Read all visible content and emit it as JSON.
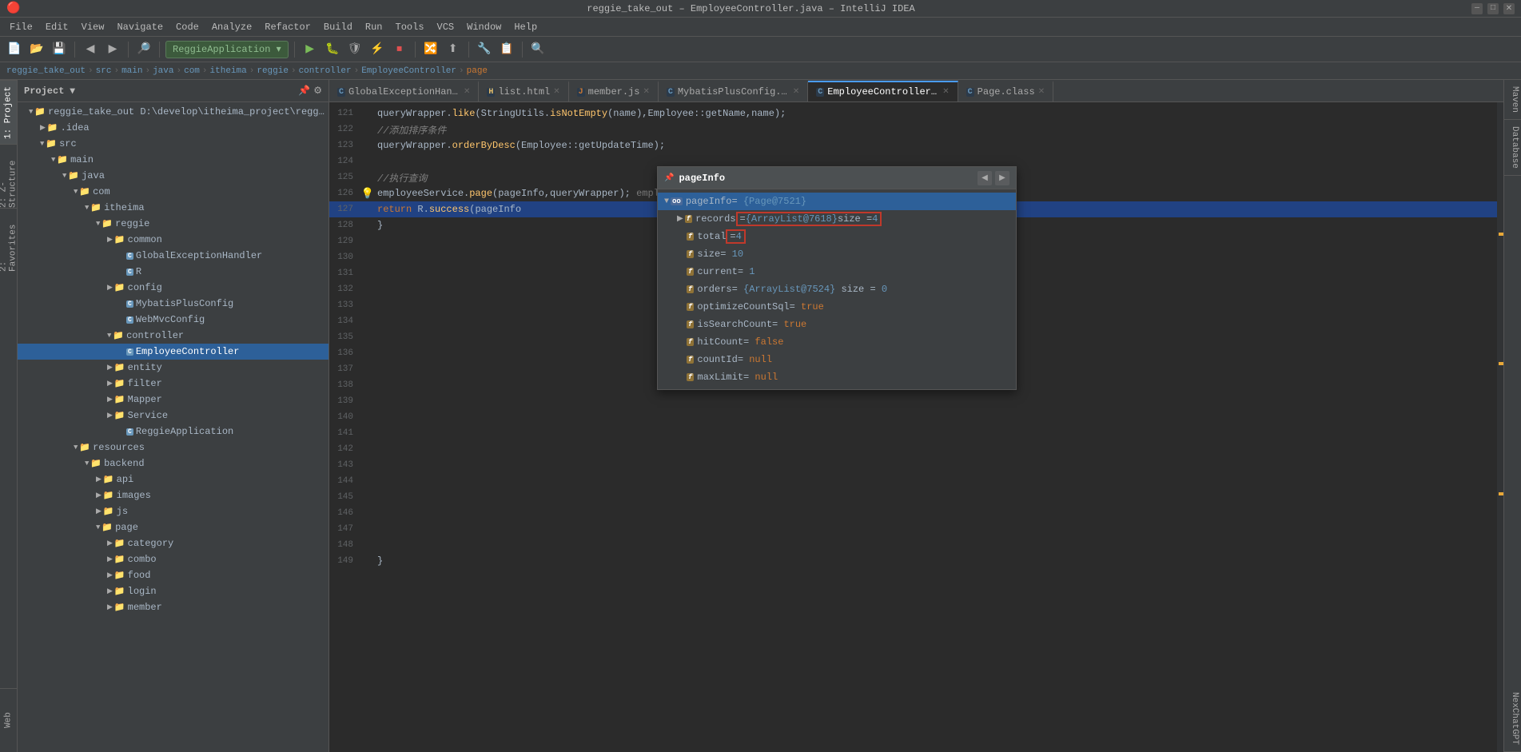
{
  "titlebar": {
    "title": "reggie_take_out – EmployeeController.java – IntelliJ IDEA",
    "min": "—",
    "max": "□",
    "close": "✕"
  },
  "menubar": {
    "items": [
      "File",
      "Edit",
      "View",
      "Navigate",
      "Code",
      "Analyze",
      "Refactor",
      "Build",
      "Run",
      "Tools",
      "VCS",
      "Window",
      "Help"
    ]
  },
  "breadcrumb": {
    "items": [
      "reggie_take_out",
      "src",
      "main",
      "java",
      "com",
      "itheima",
      "reggie",
      "controller",
      "EmployeeController"
    ],
    "current": "page"
  },
  "tabs": [
    {
      "id": "t1",
      "label": "GlobalExceptionHandler.java",
      "type": "c",
      "active": false
    },
    {
      "id": "t2",
      "label": "list.html",
      "type": "html",
      "active": false
    },
    {
      "id": "t3",
      "label": "member.js",
      "type": "js",
      "active": false
    },
    {
      "id": "t4",
      "label": "MybatisPlusConfig.java",
      "type": "c",
      "active": false
    },
    {
      "id": "t5",
      "label": "EmployeeController.java",
      "type": "c",
      "active": true
    },
    {
      "id": "t6",
      "label": "Page.class",
      "type": "c",
      "active": false
    }
  ],
  "code": {
    "lines": [
      {
        "num": "121",
        "content": "queryWrapper.like(StringUtils.isNotEmpty(name),Employee::getName,name);",
        "highlight": false,
        "selected": false
      },
      {
        "num": "122",
        "content": "//添加排序条件",
        "highlight": false,
        "selected": false
      },
      {
        "num": "123",
        "content": "queryWrapper.orderByDesc(Employee::getUpdateTime);",
        "highlight": false,
        "selected": false
      },
      {
        "num": "124",
        "content": "",
        "highlight": false,
        "selected": false
      },
      {
        "num": "125",
        "content": "//执行查询",
        "highlight": false,
        "selected": false
      },
      {
        "num": "126",
        "content": "employeeService.page(pageInfo,queryWrapper);  employeeService: \"com.itheima.reggie.Service.impl.EmployeeServ",
        "highlight": false,
        "selected": false,
        "warn": true
      },
      {
        "num": "127",
        "content": "return R.success(pageInfo",
        "highlight": true,
        "selected": true
      },
      {
        "num": "128",
        "content": "}",
        "highlight": false,
        "selected": false
      },
      {
        "num": "129",
        "content": "",
        "highlight": false,
        "selected": false
      },
      {
        "num": "130",
        "content": "",
        "highlight": false,
        "selected": false
      },
      {
        "num": "131",
        "content": "",
        "highlight": false,
        "selected": false
      },
      {
        "num": "132",
        "content": "",
        "highlight": false,
        "selected": false
      },
      {
        "num": "133",
        "content": "",
        "highlight": false,
        "selected": false
      },
      {
        "num": "134",
        "content": "",
        "highlight": false,
        "selected": false
      },
      {
        "num": "135",
        "content": "",
        "highlight": false,
        "selected": false
      },
      {
        "num": "136",
        "content": "",
        "highlight": false,
        "selected": false
      },
      {
        "num": "137",
        "content": "",
        "highlight": false,
        "selected": false
      },
      {
        "num": "138",
        "content": "",
        "highlight": false,
        "selected": false
      },
      {
        "num": "139",
        "content": "",
        "highlight": false,
        "selected": false
      },
      {
        "num": "140",
        "content": "",
        "highlight": false,
        "selected": false
      },
      {
        "num": "141",
        "content": "",
        "highlight": false,
        "selected": false
      },
      {
        "num": "142",
        "content": "",
        "highlight": false,
        "selected": false
      },
      {
        "num": "143",
        "content": "",
        "highlight": false,
        "selected": false
      },
      {
        "num": "144",
        "content": "",
        "highlight": false,
        "selected": false
      },
      {
        "num": "145",
        "content": "",
        "highlight": false,
        "selected": false
      },
      {
        "num": "146",
        "content": "",
        "highlight": false,
        "selected": false
      },
      {
        "num": "147",
        "content": "",
        "highlight": false,
        "selected": false
      },
      {
        "num": "148",
        "content": "",
        "highlight": false,
        "selected": false
      },
      {
        "num": "149",
        "content": "}",
        "highlight": false,
        "selected": false
      }
    ]
  },
  "debug_popup": {
    "title": "pageInfo",
    "nodes": [
      {
        "id": "n1",
        "indent": 0,
        "type": "obj",
        "expanded": true,
        "name": "pageInfo",
        "value": "= {Page@7521}",
        "selected": true,
        "highlight": false
      },
      {
        "id": "n2",
        "indent": 1,
        "type": "field",
        "expanded": true,
        "name": "records",
        "value": "= {ArrayList@7618}  size = 4",
        "selected": false,
        "highlight": true,
        "boxed": true
      },
      {
        "id": "n3",
        "indent": 1,
        "type": "field",
        "expanded": false,
        "name": "total",
        "value": "= 4",
        "selected": false,
        "highlight": false,
        "boxed": true
      },
      {
        "id": "n4",
        "indent": 1,
        "type": "field",
        "expanded": false,
        "name": "size",
        "value": "= 10",
        "selected": false,
        "highlight": false,
        "boxed": false
      },
      {
        "id": "n5",
        "indent": 1,
        "type": "field",
        "expanded": false,
        "name": "current",
        "value": "= 1",
        "selected": false,
        "highlight": false,
        "boxed": false
      },
      {
        "id": "n6",
        "indent": 1,
        "type": "field",
        "expanded": false,
        "name": "orders",
        "value": "= {ArrayList@7524}  size = 0",
        "selected": false,
        "highlight": false,
        "boxed": false
      },
      {
        "id": "n7",
        "indent": 1,
        "type": "field",
        "expanded": false,
        "name": "optimizeCountSql",
        "value": "= true",
        "selected": false,
        "highlight": false,
        "boxed": false
      },
      {
        "id": "n8",
        "indent": 1,
        "type": "field",
        "expanded": false,
        "name": "isSearchCount",
        "value": "= true",
        "selected": false,
        "highlight": false,
        "boxed": false
      },
      {
        "id": "n9",
        "indent": 1,
        "type": "field",
        "expanded": false,
        "name": "hitCount",
        "value": "= false",
        "selected": false,
        "highlight": false,
        "boxed": false
      },
      {
        "id": "n10",
        "indent": 1,
        "type": "field",
        "expanded": false,
        "name": "countId",
        "value": "= null",
        "selected": false,
        "highlight": false,
        "boxed": false
      },
      {
        "id": "n11",
        "indent": 1,
        "type": "field",
        "expanded": false,
        "name": "maxLimit",
        "value": "= null",
        "selected": false,
        "highlight": false,
        "boxed": false
      }
    ]
  },
  "project_tree": {
    "items": [
      {
        "indent": 1,
        "icon": "folder",
        "label": "reggie_take_out D:\\develop\\itheima_project\\reggie_ta...",
        "expanded": true,
        "type": "root"
      },
      {
        "indent": 2,
        "icon": "folder",
        "label": ".idea",
        "expanded": false,
        "type": "folder"
      },
      {
        "indent": 2,
        "icon": "folder",
        "label": "src",
        "expanded": true,
        "type": "folder"
      },
      {
        "indent": 3,
        "icon": "folder",
        "label": "main",
        "expanded": true,
        "type": "folder"
      },
      {
        "indent": 4,
        "icon": "folder",
        "label": "java",
        "expanded": true,
        "type": "folder"
      },
      {
        "indent": 5,
        "icon": "folder",
        "label": "com",
        "expanded": true,
        "type": "folder"
      },
      {
        "indent": 6,
        "icon": "folder",
        "label": "itheima",
        "expanded": true,
        "type": "folder"
      },
      {
        "indent": 7,
        "icon": "folder",
        "label": "reggie",
        "expanded": true,
        "type": "folder"
      },
      {
        "indent": 8,
        "icon": "folder",
        "label": "common",
        "expanded": false,
        "type": "folder"
      },
      {
        "indent": 9,
        "icon": "java",
        "label": "GlobalExceptionHandler",
        "expanded": false,
        "type": "java"
      },
      {
        "indent": 9,
        "icon": "java",
        "label": "R",
        "expanded": false,
        "type": "java"
      },
      {
        "indent": 8,
        "icon": "folder",
        "label": "config",
        "expanded": false,
        "type": "folder"
      },
      {
        "indent": 9,
        "icon": "java",
        "label": "MybatisPlusConfig",
        "expanded": false,
        "type": "java"
      },
      {
        "indent": 9,
        "icon": "java",
        "label": "WebMvcConfig",
        "expanded": false,
        "type": "java"
      },
      {
        "indent": 8,
        "icon": "folder",
        "label": "controller",
        "expanded": true,
        "type": "folder"
      },
      {
        "indent": 9,
        "icon": "java",
        "label": "EmployeeController",
        "expanded": false,
        "type": "java",
        "selected": true
      },
      {
        "indent": 8,
        "icon": "folder",
        "label": "entity",
        "expanded": false,
        "type": "folder"
      },
      {
        "indent": 8,
        "icon": "folder",
        "label": "filter",
        "expanded": false,
        "type": "folder"
      },
      {
        "indent": 8,
        "icon": "folder",
        "label": "Mapper",
        "expanded": false,
        "type": "folder"
      },
      {
        "indent": 8,
        "icon": "folder",
        "label": "Service",
        "expanded": false,
        "type": "folder"
      },
      {
        "indent": 9,
        "icon": "java",
        "label": "ReggieApplication",
        "expanded": false,
        "type": "java"
      },
      {
        "indent": 5,
        "icon": "folder",
        "label": "resources",
        "expanded": true,
        "type": "folder"
      },
      {
        "indent": 6,
        "icon": "folder",
        "label": "backend",
        "expanded": true,
        "type": "folder"
      },
      {
        "indent": 7,
        "icon": "folder",
        "label": "api",
        "expanded": false,
        "type": "folder"
      },
      {
        "indent": 7,
        "icon": "folder",
        "label": "images",
        "expanded": false,
        "type": "folder"
      },
      {
        "indent": 7,
        "icon": "folder",
        "label": "js",
        "expanded": false,
        "type": "folder"
      },
      {
        "indent": 7,
        "icon": "folder",
        "label": "page",
        "expanded": true,
        "type": "folder"
      },
      {
        "indent": 8,
        "icon": "folder",
        "label": "category",
        "expanded": false,
        "type": "folder"
      },
      {
        "indent": 8,
        "icon": "folder",
        "label": "combo",
        "expanded": false,
        "type": "folder"
      },
      {
        "indent": 8,
        "icon": "folder",
        "label": "food",
        "expanded": false,
        "type": "folder"
      },
      {
        "indent": 8,
        "icon": "folder",
        "label": "login",
        "expanded": false,
        "type": "folder"
      },
      {
        "indent": 8,
        "icon": "folder",
        "label": "member",
        "expanded": false,
        "type": "folder"
      }
    ]
  },
  "right_panels": [
    "Maven",
    "Database",
    "NexChat"
  ],
  "left_panels": [
    "1: Project",
    "2: Z-Structure",
    "2: Favorites",
    "Web"
  ]
}
